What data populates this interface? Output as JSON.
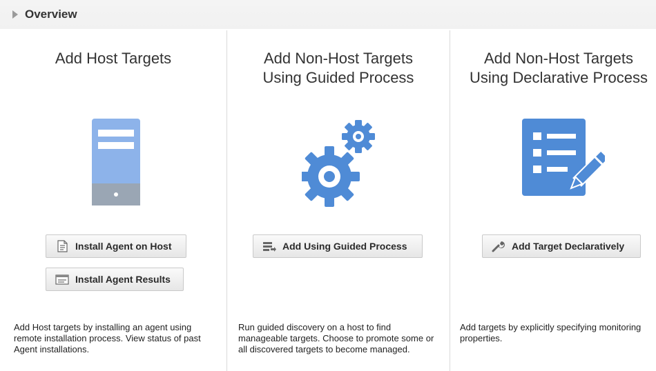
{
  "overview": {
    "title": "Overview"
  },
  "columns": [
    {
      "heading_lines": [
        "Add Host Targets"
      ],
      "icon": "server-icon",
      "buttons": [
        {
          "label": "Install Agent on Host",
          "icon": "document-icon"
        },
        {
          "label": "Install Agent Results",
          "icon": "window-icon"
        }
      ],
      "description": "Add Host targets by installing an agent using remote installation process. View status of past Agent installations."
    },
    {
      "heading_lines": [
        "Add Non-Host Targets",
        "Using Guided Process"
      ],
      "icon": "gears-icon",
      "buttons": [
        {
          "label": "Add Using Guided Process",
          "icon": "list-arrow-icon"
        }
      ],
      "description": "Run guided discovery on a host to find manageable targets. Choose to promote some or all discovered targets to become managed."
    },
    {
      "heading_lines": [
        "Add Non-Host Targets",
        "Using Declarative Process"
      ],
      "icon": "checklist-pencil-icon",
      "buttons": [
        {
          "label": "Add Target Declaratively",
          "icon": "wrench-icon"
        }
      ],
      "description": "Add targets by explicitly specifying monitoring properties."
    }
  ],
  "colors": {
    "icon_blue": "#4f8bd6",
    "icon_light_blue": "#8db3ea",
    "icon_gray": "#9aa6b4",
    "divider": "#d9d9d9"
  }
}
